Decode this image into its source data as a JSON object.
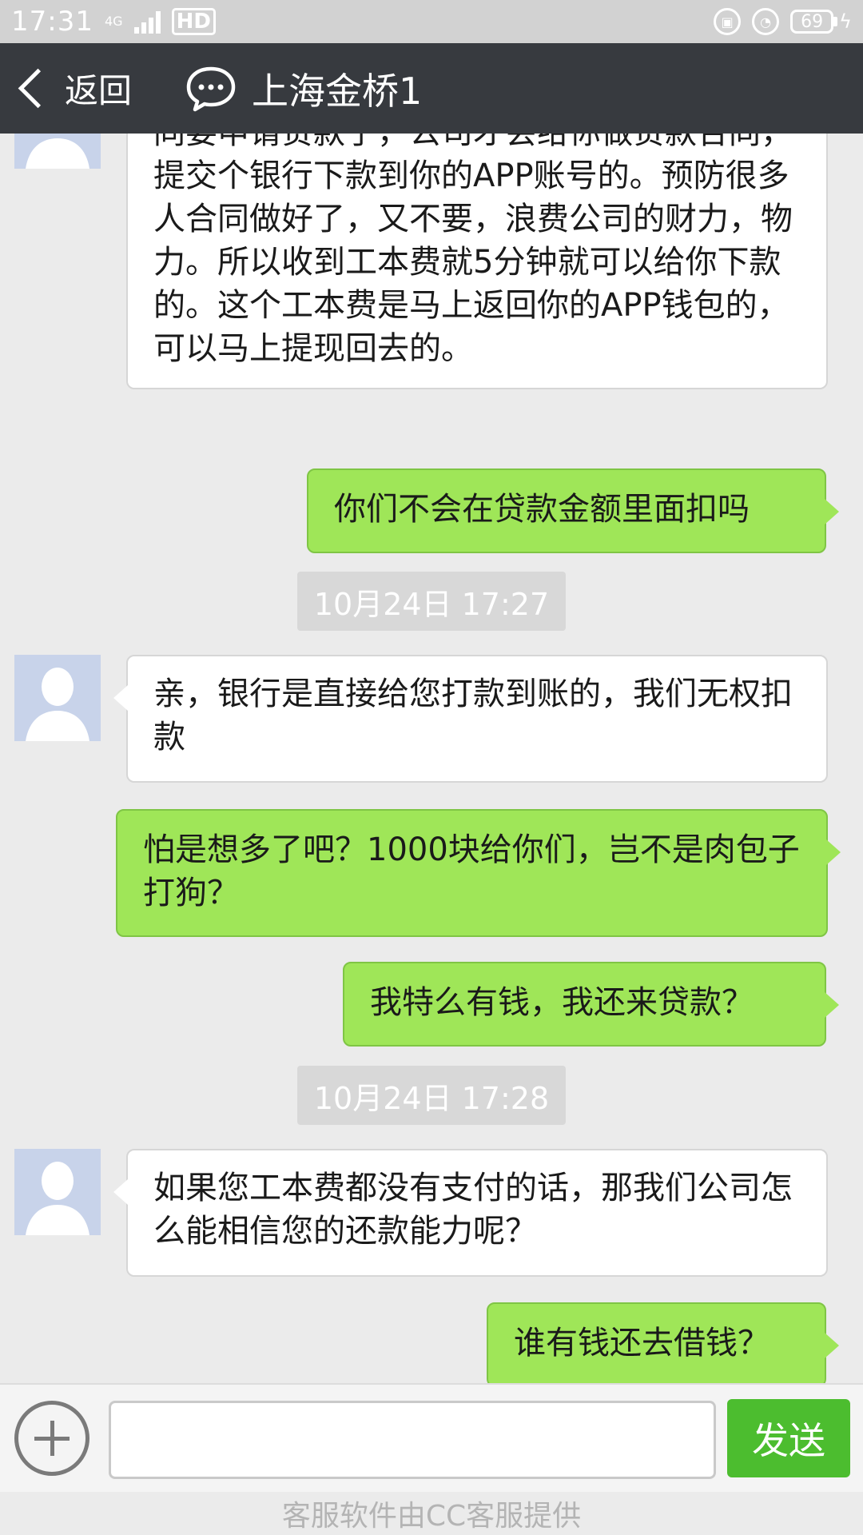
{
  "status_bar": {
    "time": "17:31",
    "network": "4G",
    "hd": "HD",
    "battery": "69"
  },
  "header": {
    "back_label": "返回",
    "title": "上海金桥1"
  },
  "messages": [
    {
      "side": "left",
      "text": "同要申请贷款了，公司才会给你做贷款合同，提交个银行下款到你的APP账号的。预防很多人合同做好了，又不要，浪费公司的财力，物力。所以收到工本费就5分钟就可以给你下款的。这个工本费是马上返回你的APP钱包的，可以马上提现回去的。"
    },
    {
      "side": "right",
      "text": "你们不会在贷款金额里面扣吗"
    },
    {
      "side": "time",
      "text": "10月24日 17:27"
    },
    {
      "side": "left",
      "text": "亲，银行是直接给您打款到账的，我们无权扣款"
    },
    {
      "side": "right",
      "text": "怕是想多了吧？1000块给你们，岂不是肉包子打狗？"
    },
    {
      "side": "right",
      "text": "我特么有钱，我还来贷款？"
    },
    {
      "side": "time",
      "text": "10月24日 17:28"
    },
    {
      "side": "left",
      "text": "如果您工本费都没有支付的话，那我们公司怎么能相信您的还款能力呢？"
    },
    {
      "side": "right",
      "text": "谁有钱还去借钱？"
    }
  ],
  "input": {
    "value": "",
    "send_label": "发送"
  },
  "footer": "客服软件由CC客服提供",
  "colors": {
    "header_bg": "#373a3f",
    "sent_bubble": "#9fe658",
    "send_button": "#4cbd2f",
    "chat_bg": "#ebebeb"
  }
}
